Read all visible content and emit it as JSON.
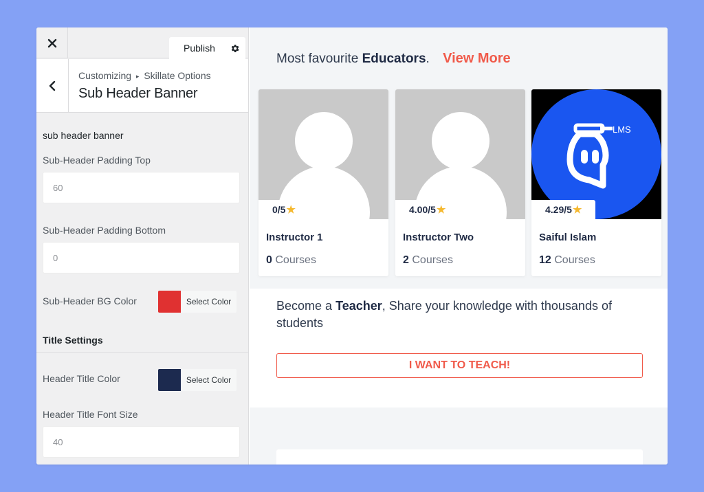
{
  "customizer": {
    "close_icon": "close-icon",
    "publish_label": "Publish",
    "gear_icon": "gear-icon",
    "back_icon": "chevron-left-icon",
    "breadcrumb": {
      "root": "Customizing",
      "separator": "▸",
      "parent": "Skillate Options"
    },
    "section_title": "Sub Header Banner",
    "section_label": "sub header banner",
    "padding_top": {
      "label": "Sub-Header Padding Top",
      "value": "60"
    },
    "padding_bottom": {
      "label": "Sub-Header Padding Bottom",
      "value": "0"
    },
    "bg_color": {
      "label": "Sub-Header BG Color",
      "button": "Select Color",
      "color": "#e03131"
    },
    "title_settings": "Title Settings",
    "title_color": {
      "label": "Header Title Color",
      "button": "Select Color",
      "color": "#1c2a4f"
    },
    "title_font_size": {
      "label": "Header Title Font Size",
      "value": "40"
    }
  },
  "preview": {
    "heading_prefix": "Most favourite",
    "heading_bold": "Educators",
    "heading_suffix": ".",
    "view_more": "View More",
    "educators": [
      {
        "rating": "0/5",
        "name": "Instructor 1",
        "courses_count": "0",
        "courses_label": "Courses"
      },
      {
        "rating": "4.00/5",
        "name": "Instructor Two",
        "courses_count": "2",
        "courses_label": "Courses"
      },
      {
        "rating": "4.29/5",
        "name": "Saiful Islam",
        "courses_count": "12",
        "courses_label": "Courses",
        "logo_text": "LMS"
      }
    ],
    "teach_prefix": "Become a",
    "teach_bold": "Teacher",
    "teach_suffix": ", Share your knowledge with thousands of students",
    "teach_button": "I WANT TO TEACH!"
  },
  "colors": {
    "accent": "#f05a4a",
    "navy": "#1f2a44",
    "brand_blue": "#1a56f0",
    "star": "#f5b82e"
  }
}
